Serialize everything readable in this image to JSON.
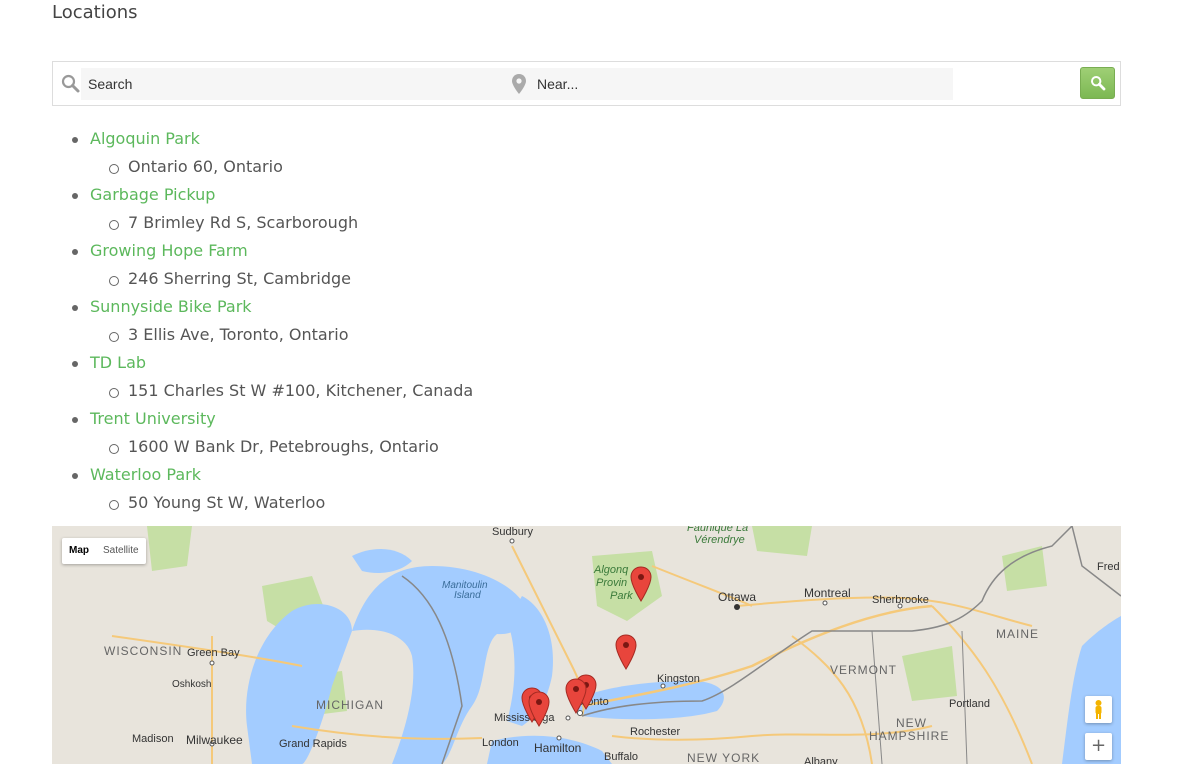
{
  "page": {
    "title": "Locations"
  },
  "search": {
    "keyword_placeholder": "Search",
    "near_placeholder": "Near...",
    "button_icon": "search-icon"
  },
  "locations": [
    {
      "name": "Algoquin Park",
      "address": "Ontario 60, Ontario"
    },
    {
      "name": "Garbage Pickup",
      "address": "7 Brimley Rd S, Scarborough"
    },
    {
      "name": "Growing Hope Farm",
      "address": "246 Sherring St, Cambridge"
    },
    {
      "name": "Sunnyside Bike Park",
      "address": "3 Ellis Ave, Toronto, Ontario"
    },
    {
      "name": "TD Lab",
      "address": "151 Charles St W #100, Kitchener, Canada"
    },
    {
      "name": "Trent University",
      "address": "1600 W Bank Dr, Petebroughs, Ontario"
    },
    {
      "name": "Waterloo Park",
      "address": "50 Young St W, Waterloo"
    }
  ],
  "map": {
    "type_control": {
      "map": "Map",
      "satellite": "Satellite"
    },
    "zoom_in": "+",
    "labels": {
      "sudbury": "Sudbury",
      "reserve_line1": "Faunique La",
      "reserve_line2": "Vérendrye",
      "fred": "Fred",
      "manitoulin_line1": "Manitoulin",
      "manitoulin_line2": "Island",
      "algonquin_line1": "Algonq",
      "algonquin_line2": "Provin",
      "algonquin_line3": "Park",
      "ottawa": "Ottawa",
      "montreal": "Montreal",
      "sherbrooke": "Sherbrooke",
      "wisconsin": "WISCONSIN",
      "green_bay": "Green Bay",
      "maine": "MAINE",
      "vermont": "VERMONT",
      "kingston": "Kingston",
      "oshkosh": "Oshkosh",
      "michigan": "MICHIGAN",
      "toronto": "Toronto",
      "mississauga": "Mississauga",
      "portland": "Portland",
      "new_hampshire_line1": "NEW",
      "new_hampshire_line2": "HAMPSHIRE",
      "rochester": "Rochester",
      "madison": "Madison",
      "milwaukee": "Milwaukee",
      "grand_rapids": "Grand Rapids",
      "london": "London",
      "hamilton": "Hamilton",
      "buffalo": "Buffalo",
      "new_york": "NEW YORK",
      "albany": "Albany"
    },
    "colors": {
      "water": "#a3ccff",
      "land": "#e8e4dc",
      "park": "#c6dfa5",
      "road": "#f5c97a",
      "marker": "#e8453c"
    }
  }
}
